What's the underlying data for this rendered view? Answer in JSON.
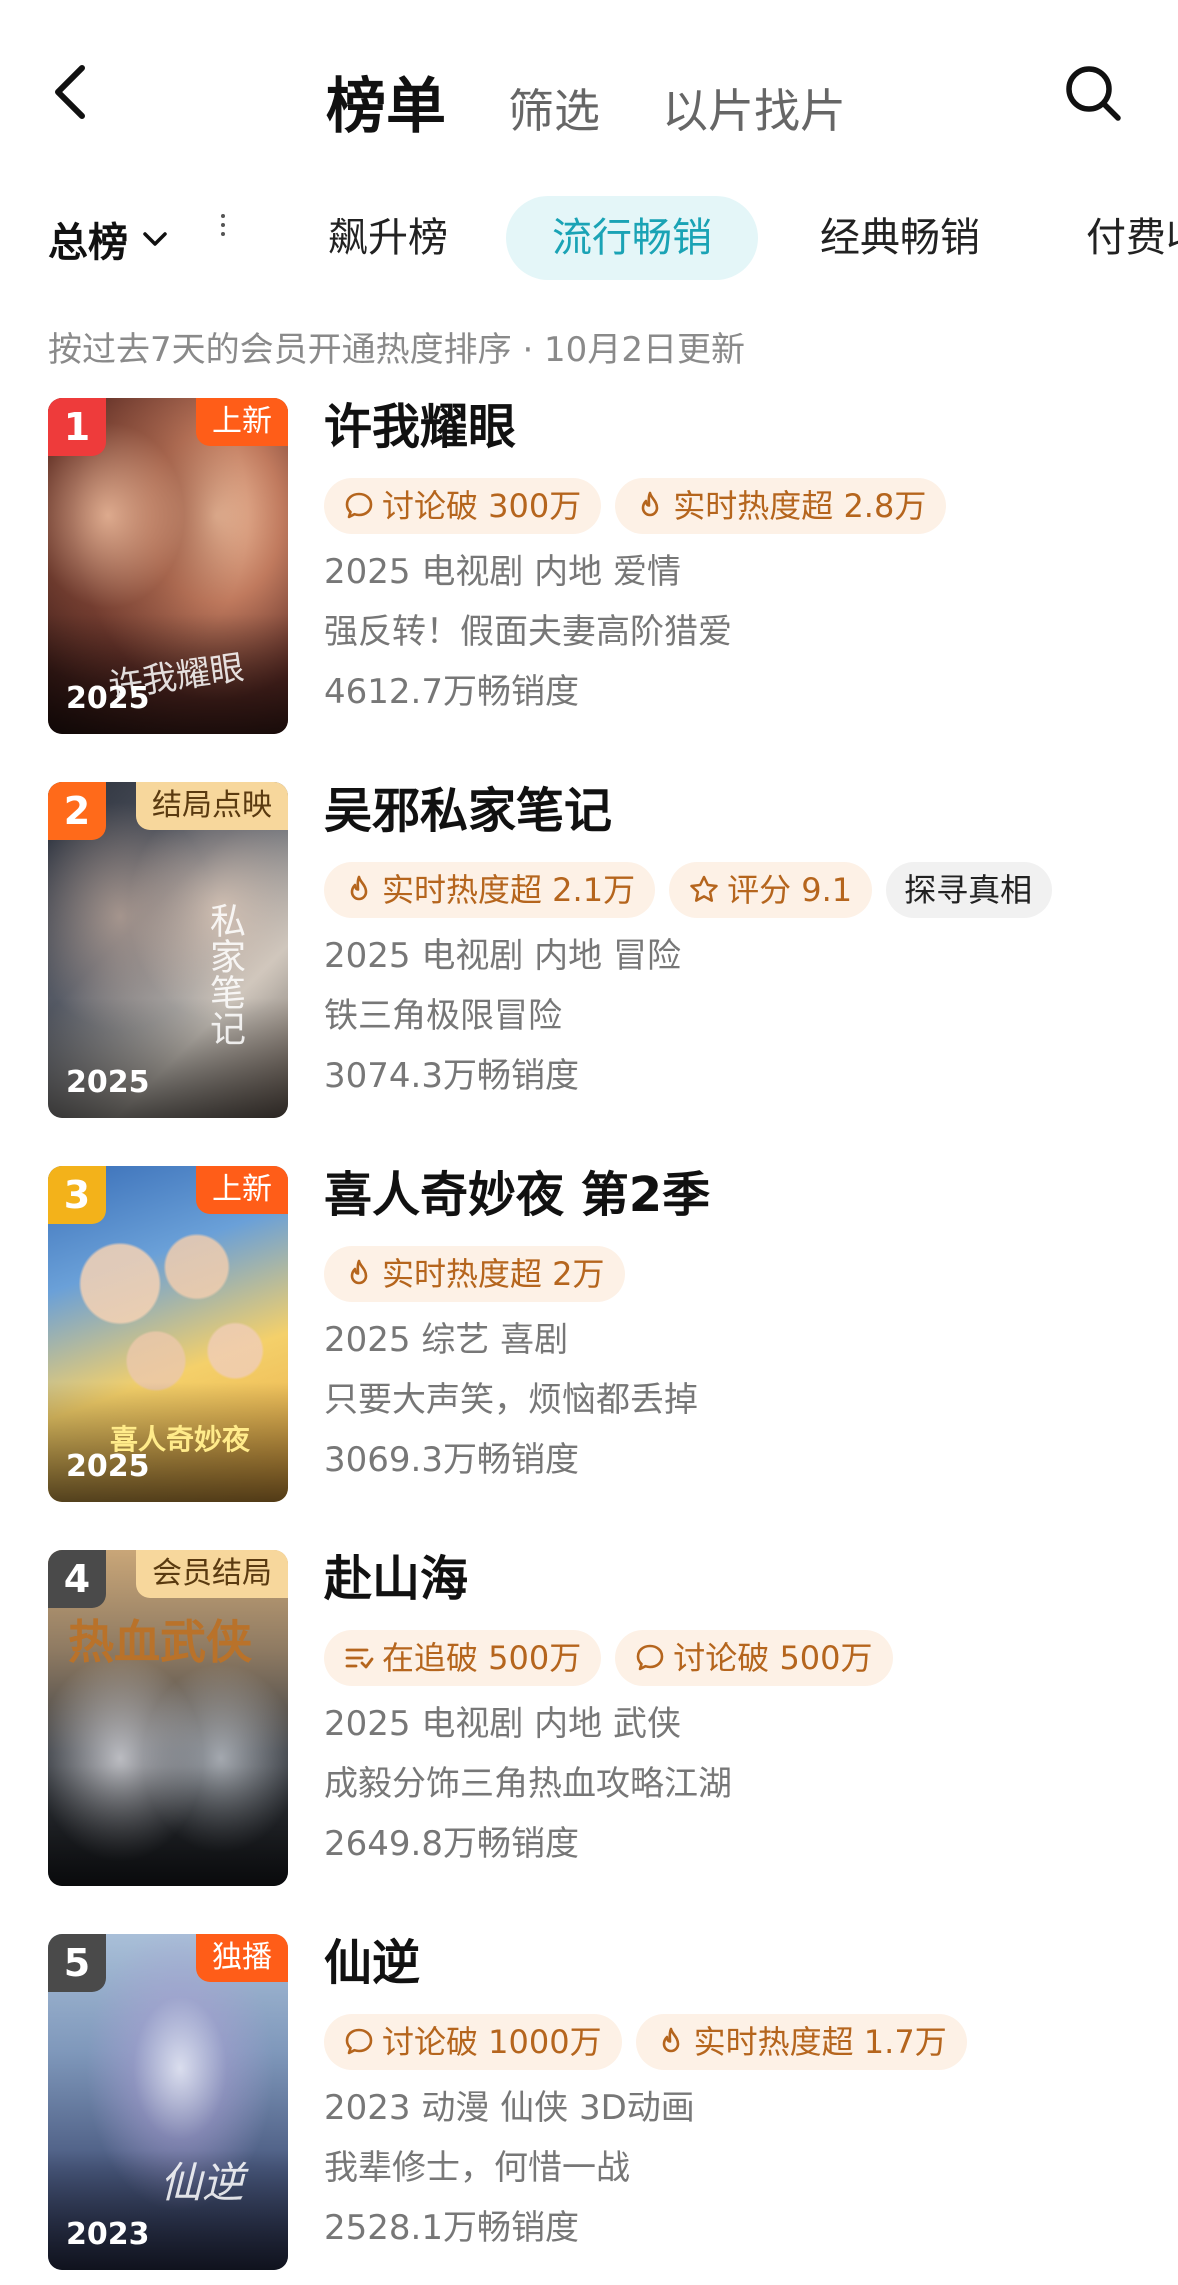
{
  "header": {
    "back_icon": "back-icon",
    "tabs": [
      {
        "label": "榜单"
      },
      {
        "label": "筛选"
      },
      {
        "label": "以片找片"
      }
    ],
    "search_icon": "search-icon"
  },
  "categories": {
    "total_label": "总榜",
    "tabs": [
      {
        "label": "飙升榜"
      },
      {
        "label": "流行畅销"
      },
      {
        "label": "经典畅销"
      },
      {
        "label": "付费收"
      }
    ]
  },
  "subtitle": "按过去7天的会员开通热度排序 · 10月2日更新",
  "colors": {
    "accent_teal": "#1aa3b5",
    "rank1": "#ee3b3b",
    "rank2": "#ff6a1a",
    "rank3": "#f3b21a",
    "rank_other": "#4a4a4a",
    "chip_bg": "#fdf1e6",
    "chip_text": "#b5651d"
  },
  "items": [
    {
      "rank": "1",
      "badge": "上新",
      "year": "2025",
      "poster_text": "许我耀眼",
      "title": "许我耀眼",
      "chips": [
        {
          "icon": "comment-icon",
          "text": "讨论破 300万"
        },
        {
          "icon": "flame-icon",
          "text": "实时热度超 2.8万"
        }
      ],
      "meta": "2025 电视剧 内地 爱情",
      "desc": "强反转！假面夫妻高阶猎爱",
      "sales": "4612.7万畅销度"
    },
    {
      "rank": "2",
      "badge": "结局点映",
      "year": "2025",
      "poster_text": "私家笔记",
      "title": "吴邪私家笔记",
      "chips": [
        {
          "icon": "flame-icon",
          "text": "实时热度超 2.1万"
        },
        {
          "icon": "star-icon",
          "text": "评分 9.1"
        },
        {
          "icon": "",
          "text": "探寻真相"
        }
      ],
      "meta": "2025 电视剧 内地 冒险",
      "desc": "铁三角极限冒险",
      "sales": "3074.3万畅销度"
    },
    {
      "rank": "3",
      "badge": "上新",
      "year": "2025",
      "poster_text": "喜人奇妙夜",
      "title": "喜人奇妙夜 第2季",
      "chips": [
        {
          "icon": "flame-icon",
          "text": "实时热度超 2万"
        }
      ],
      "meta": "2025 综艺 喜剧",
      "desc": "只要大声笑，烦恼都丢掉",
      "sales": "3069.3万畅销度"
    },
    {
      "rank": "4",
      "badge": "会员结局",
      "year": "",
      "poster_text": "热血武侠",
      "title": "赴山海",
      "chips": [
        {
          "icon": "list-icon",
          "text": "在追破 500万"
        },
        {
          "icon": "comment-icon",
          "text": "讨论破 500万"
        }
      ],
      "meta": "2025 电视剧 内地 武侠",
      "desc": "成毅分饰三角热血攻略江湖",
      "sales": "2649.8万畅销度"
    },
    {
      "rank": "5",
      "badge": "独播",
      "year": "2023",
      "poster_text": "仙逆",
      "title": "仙逆",
      "chips": [
        {
          "icon": "comment-icon",
          "text": "讨论破 1000万"
        },
        {
          "icon": "flame-icon",
          "text": "实时热度超 1.7万"
        }
      ],
      "meta": "2023 动漫 仙侠 3D动画",
      "desc": "我辈修士，何惜一战",
      "sales": "2528.1万畅销度"
    }
  ]
}
